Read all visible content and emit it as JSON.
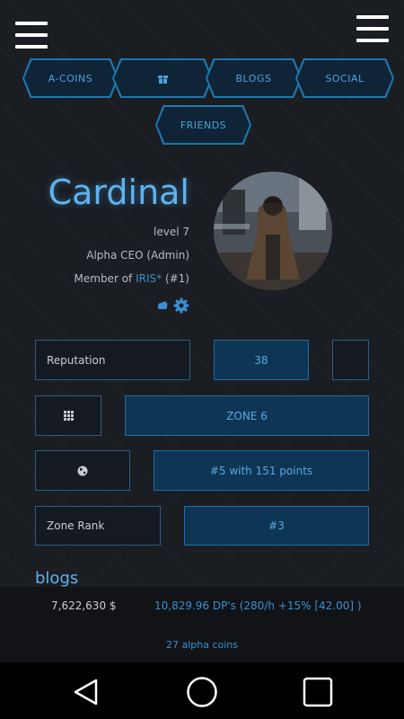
{
  "nav": {
    "tabs": [
      {
        "label": "A-COINS"
      },
      {
        "label": ""
      },
      {
        "label": "BLOGS"
      },
      {
        "label": "SOCIAL"
      },
      {
        "label": "FRIENDS"
      }
    ]
  },
  "profile": {
    "name": "Cardinal",
    "level": "level 7",
    "role": "Alpha CEO (Admin)",
    "member_prefix": "Member of ",
    "member_group": "IRIS*",
    "member_suffix": " (#1)"
  },
  "stats": {
    "reputation_label": "Reputation",
    "reputation_value": "38",
    "zone_value": "ZONE 6",
    "points_value": "#5 with 151 points",
    "zone_rank_label": "Zone Rank",
    "zone_rank_value": "#3"
  },
  "section": {
    "blogs_title": "blogs"
  },
  "footer": {
    "money": "7,622,630 $",
    "dp": "10,829.96 DP's (280/h +15% [42.00] )",
    "alpha_coins": "27 alpha coins"
  },
  "colors": {
    "accent": "#5fb2ee",
    "button_fill": "#0e3553",
    "border": "#2b5f86"
  }
}
